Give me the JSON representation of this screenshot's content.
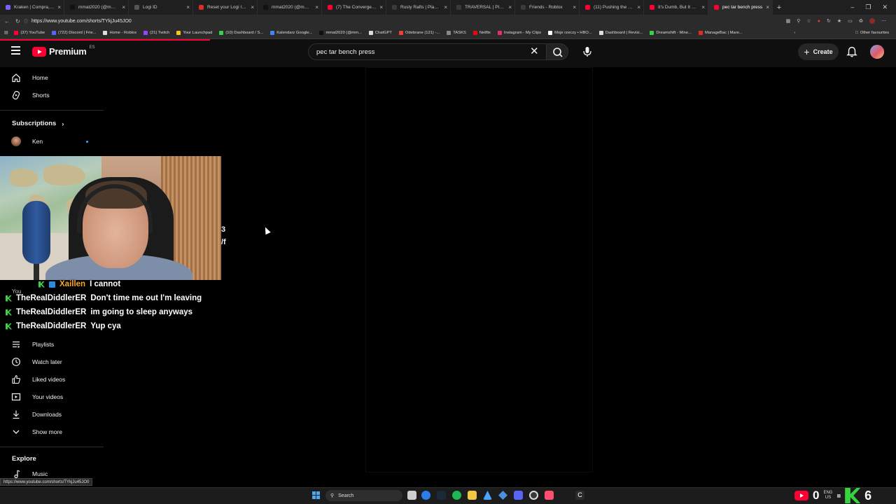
{
  "browser": {
    "tabs": [
      {
        "title": "Kraken | Compra, vende y...",
        "color": "#7b61ff",
        "active": false
      },
      {
        "title": "mmat2020 (@mmat2020)...",
        "color": "#111111",
        "active": false
      },
      {
        "title": "Logi ID",
        "color": "#555555",
        "active": false
      },
      {
        "title": "Reset your Logi ID passw...",
        "color": "#d93025",
        "active": false
      },
      {
        "title": "mmat2020 (@mmat2020)...",
        "color": "#111111",
        "active": false
      },
      {
        "title": "(7) The Convergence Mu...",
        "color": "#ff0033",
        "active": false
      },
      {
        "title": "Rusty Rafts | Play on Rob...",
        "color": "#3a3a3a",
        "active": false
      },
      {
        "title": "TRAVERSAL | Play on Rob...",
        "color": "#3a3a3a",
        "active": false
      },
      {
        "title": "Friends - Roblox",
        "color": "#3a3a3a",
        "active": false
      },
      {
        "title": "(11) Pushing the human...",
        "color": "#ff0033",
        "active": false
      },
      {
        "title": "It's Dumb, But It Builds M...",
        "color": "#ff0033",
        "active": false
      },
      {
        "title": "pec tar bench press",
        "color": "#ff0033",
        "active": true
      }
    ],
    "url": "https://www.youtube.com/shorts/TYkjJu45JO0",
    "bookmarks": [
      {
        "label": "(37) YouTube",
        "color": "#ff0033"
      },
      {
        "label": "(722) Discord | Frie...",
        "color": "#5865f2"
      },
      {
        "label": "Home - Roblox",
        "color": "#dddddd"
      },
      {
        "label": "(21) Twitch",
        "color": "#9146ff"
      },
      {
        "label": "Your Launchpad",
        "color": "#f5c518"
      },
      {
        "label": "(10) Dashboard / S...",
        "color": "#3ecf4a"
      },
      {
        "label": "Kalendarz Google...",
        "color": "#4285f4"
      },
      {
        "label": "mmat2020 (@mm...",
        "color": "#111111"
      },
      {
        "label": "ChatGPT",
        "color": "#dddddd"
      },
      {
        "label": "Odebrane (121) -...",
        "color": "#ea4335"
      },
      {
        "label": "TASKS",
        "color": "#888888"
      },
      {
        "label": "Netflix",
        "color": "#e50914"
      },
      {
        "label": "Instagram - My Clips",
        "color": "#e1306c"
      },
      {
        "label": "Moje rzeczy • HBO...",
        "color": "#ffffff"
      },
      {
        "label": "Dashboard | Revisi...",
        "color": "#dddddd"
      },
      {
        "label": "Dreamshift - Mine...",
        "color": "#3ecf4a"
      },
      {
        "label": "ManageBac | Mare...",
        "color": "#d93025"
      }
    ],
    "other_favourites": "Other favourites",
    "status_url": "https://www.youtube.com/shorts/TYkjJu45JO0"
  },
  "youtube": {
    "logo_text": "Premium",
    "logo_country": "ES",
    "search_value": "pec tar bench press",
    "create_label": "Create",
    "accent": "#ff0033"
  },
  "sidebar": {
    "home": "Home",
    "shorts": "Shorts",
    "subscriptions_heading": "Subscriptions",
    "subscription_channel": "Ken",
    "you_heading": "You",
    "playlists": "Playlists",
    "watch_later": "Watch later",
    "liked_videos": "Liked videos",
    "your_videos": "Your videos",
    "downloads": "Downloads",
    "show_more": "Show more",
    "explore_heading": "Explore",
    "music": "Music"
  },
  "overlay": {
    "partial_text_1": "3",
    "partial_text_2": "/f",
    "chat": [
      {
        "user": "Xaillen",
        "message": "I cannot",
        "user_color": "#f5a623"
      },
      {
        "user": "TheRealDiddlerER",
        "message": "Don't time me out I'm leaving",
        "user_color": "#ffffff"
      },
      {
        "user": "TheRealDiddlerER",
        "message": "im going to sleep anyways",
        "user_color": "#ffffff"
      },
      {
        "user": "TheRealDiddlerER",
        "message": "Yup cya",
        "user_color": "#ffffff"
      }
    ]
  },
  "taskbar": {
    "search_label": "Search",
    "lang_top": "ENG",
    "lang_bottom": "US",
    "left_glyph": "0",
    "right_glyph": "6"
  }
}
